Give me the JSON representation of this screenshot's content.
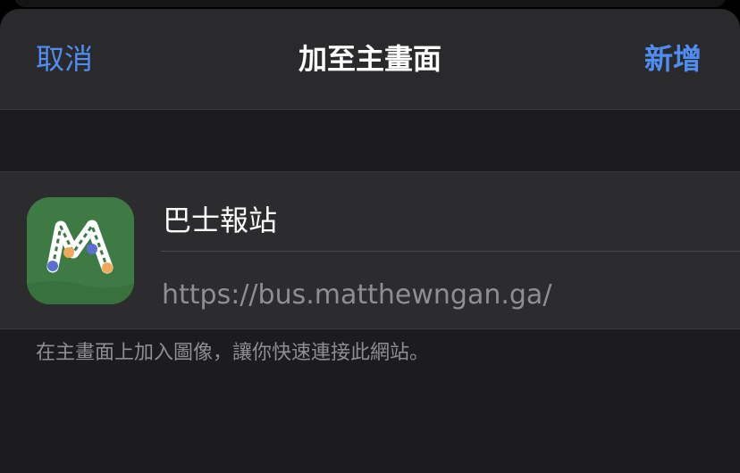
{
  "navbar": {
    "cancel_label": "取消",
    "title": "加至主畫面",
    "add_label": "新增"
  },
  "shortcut": {
    "name_value": "巴士報站",
    "url": "https://bus.matthewngan.ga/",
    "icon": "bus-route-m-app-icon"
  },
  "footnote": "在主畫面上加入圖像，讓你快速連接此網站。",
  "colors": {
    "accent": "#4f8ef0",
    "icon_background": "#3e7a44"
  }
}
